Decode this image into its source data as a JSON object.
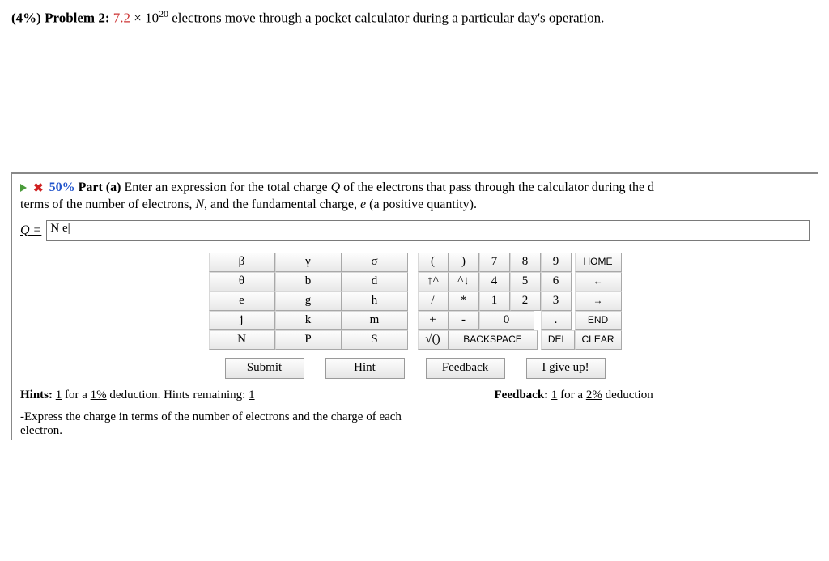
{
  "header": {
    "weight": "(4%)",
    "label": "Problem 2:",
    "value": "7.2",
    "times": " × 10",
    "exp": "20",
    "rest": " electrons move through a pocket calculator during a particular day's operation."
  },
  "part": {
    "pct": "50%",
    "label": "Part (a)",
    "text1": "  Enter an expression for the total charge ",
    "qsym": "Q",
    "text2": " of the electrons that pass through the calculator during the d",
    "line2a": "terms of the number of electrons, ",
    "nsym": "N",
    "line2b": ", and the fundamental charge, ",
    "esym": "e",
    "line2c": " (a positive quantity)."
  },
  "answer": {
    "lhs": "Q = ",
    "value": "N e"
  },
  "keypad": {
    "greek": [
      [
        "β",
        "γ",
        "σ"
      ],
      [
        "θ",
        "b",
        "d"
      ],
      [
        "e",
        "g",
        "h"
      ],
      [
        "j",
        "k",
        "m"
      ],
      [
        "N",
        "P",
        "S"
      ]
    ],
    "r1": {
      "lp": "(",
      "rp": ")",
      "n7": "7",
      "n8": "8",
      "n9": "9",
      "home": "HOME"
    },
    "r2": {
      "up": "↑^",
      "dn": "^↓",
      "n4": "4",
      "n5": "5",
      "n6": "6",
      "larr": "←"
    },
    "r3": {
      "sl": "/",
      "ast": "*",
      "n1": "1",
      "n2": "2",
      "n3": "3",
      "rarr": "→"
    },
    "r4": {
      "pl": "+",
      "mi": "-",
      "n0": "0",
      "dot": ".",
      "end": "END"
    },
    "r5": {
      "sqrt": "√()",
      "bksp": "BACKSPACE",
      "del": "DEL",
      "clear": "CLEAR"
    }
  },
  "actions": {
    "submit": "Submit",
    "hint": "Hint",
    "feedback": "Feedback",
    "giveup": "I give up!"
  },
  "hints": {
    "label": "Hints:",
    "n1": "1",
    "t1": " for a ",
    "pct": "1%",
    "t2": " deduction. Hints remaining: ",
    "n2": "1"
  },
  "feedback": {
    "label": "Feedback:",
    "n1": "1",
    "t1": " for a ",
    "pct": "2%",
    "t2": " deduction"
  },
  "hintText": "-Express the charge in terms of the number of electrons and the charge of each electron."
}
